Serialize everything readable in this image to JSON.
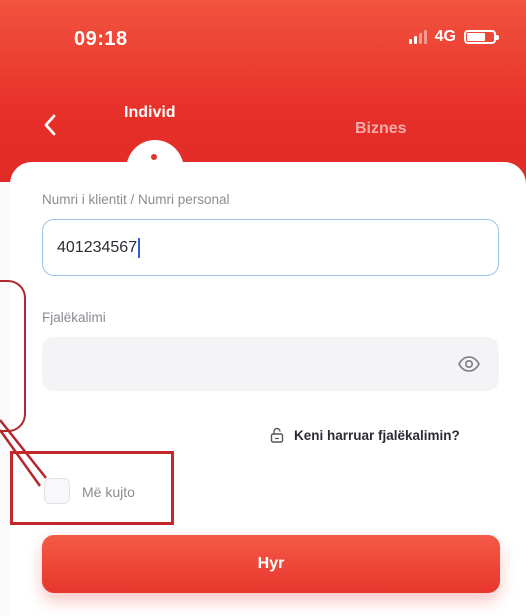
{
  "status_bar": {
    "time": "09:18",
    "network": "4G"
  },
  "nav": {
    "back_icon": "chevron-left-icon",
    "tabs": [
      {
        "label": "Individ",
        "active": true
      },
      {
        "label": "Biznes",
        "active": false
      }
    ]
  },
  "form": {
    "client_label": "Numri i klientit / Numri personal",
    "client_value": "401234567",
    "password_label": "Fjalëkalimi",
    "password_value": "",
    "eye_icon": "eye-icon",
    "forgot_icon": "lock-icon",
    "forgot_label": "Keni harruar fjalëkalimin?",
    "remember_label": "Më kujto",
    "remember_checked": false,
    "submit_label": "Hyr"
  },
  "colors": {
    "brand_red": "#e6312b",
    "focus_border": "#9cc4ea",
    "annotation_red": "#c3282c"
  }
}
